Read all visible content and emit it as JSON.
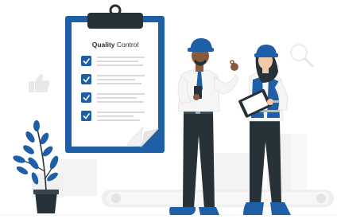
{
  "clipboard": {
    "title_bold": "Quality",
    "title_rest": " Control",
    "checklist_count": 4
  },
  "colors": {
    "primary_blue": "#1f5fa8",
    "dark_navy": "#263238",
    "light_gray": "#ececec",
    "skin_dark": "#8a5a3c",
    "skin_light": "#f2c9a8",
    "plant_blue": "#1f5fa8"
  },
  "icons": [
    "thumbs-up-icon",
    "magnifier-icon",
    "check-icon",
    "clipboard-icon",
    "plant-icon"
  ]
}
